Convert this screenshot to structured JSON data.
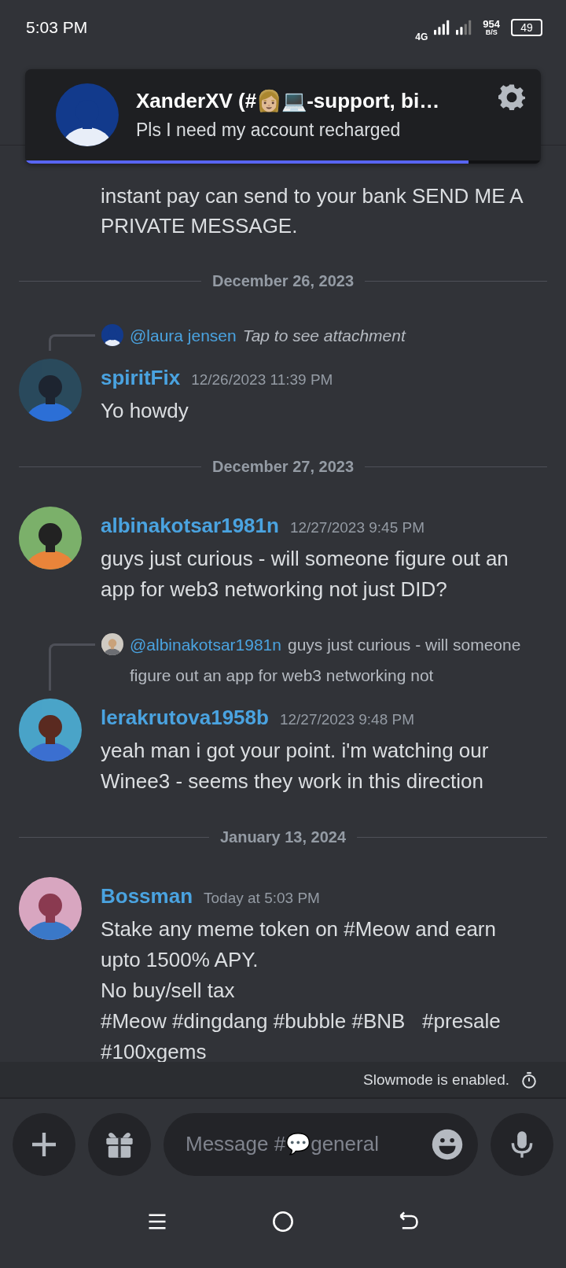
{
  "status_bar": {
    "time": "5:03 PM",
    "network": "4G",
    "speed": "954",
    "speed_unit": "B/S",
    "battery": "49"
  },
  "notification": {
    "title": "XanderXV (#👩🏼💻-support, bi…",
    "body": "Pls I need my account recharged",
    "level": 0.86
  },
  "messages": [
    {
      "kind": "continuation",
      "text": "instant pay can send to your bank SEND ME A PRIVATE MESSAGE."
    },
    {
      "kind": "date",
      "text": "December 26, 2023"
    },
    {
      "kind": "message",
      "author": "spiritFix",
      "time": "12/26/2023 11:39 PM",
      "reply": {
        "kind": "attachment",
        "mention": "@laura jensen",
        "text": "Tap to see attachment"
      },
      "text": "Yo howdy"
    },
    {
      "kind": "date",
      "text": "December 27, 2023"
    },
    {
      "kind": "message",
      "author": "albinakotsar1981n",
      "time": "12/27/2023 9:45 PM",
      "text": "guys just curious - will someone figure out an app for web3 networking not just DID?"
    },
    {
      "kind": "message",
      "author": "lerakrutova1958b",
      "time": "12/27/2023 9:48 PM",
      "reply": {
        "kind": "quote",
        "mention": "@albinakotsar1981n",
        "text": "guys just curious - will someone figure out an app for web3 networking not"
      },
      "text": "yeah man i got your point. i'm watching our Winee3 - seems they work in this direction"
    },
    {
      "kind": "date",
      "text": "January 13, 2024"
    },
    {
      "kind": "message",
      "author": "Bossman",
      "time": "Today at 5:03 PM",
      "text": "Stake any meme token on #Meow and earn upto 1500% APY.\nNo buy/sell tax\n#Meow #dingdang #bubble #BNB   #presale #100xgems"
    }
  ],
  "slowmode": {
    "text": "Slowmode is enabled."
  },
  "composer": {
    "placeholder": "Message #💬general"
  }
}
